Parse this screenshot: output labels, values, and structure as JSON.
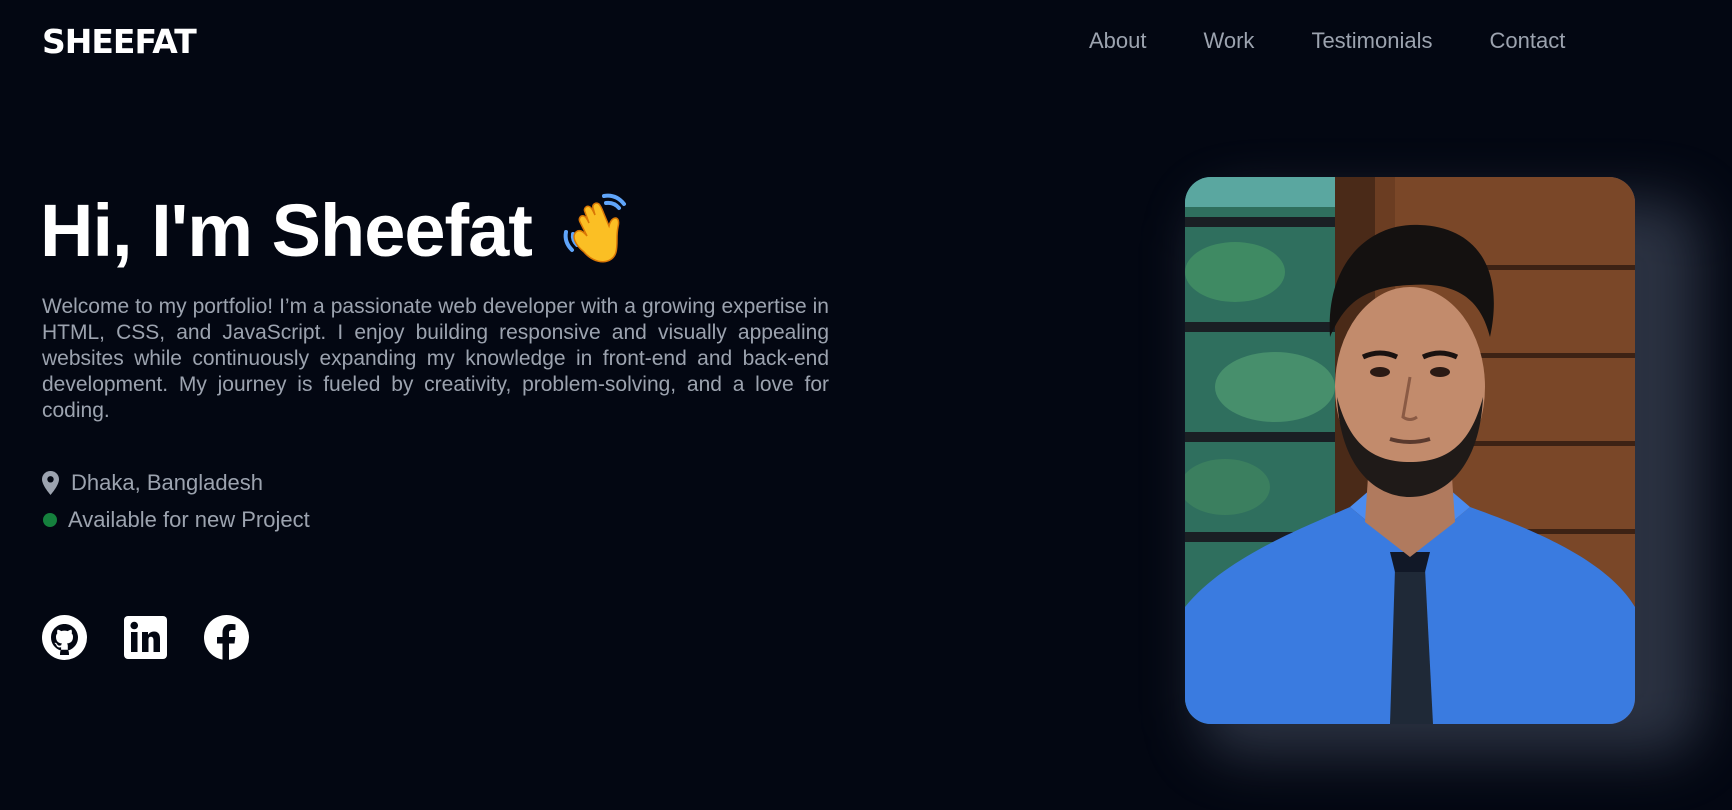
{
  "header": {
    "logo": "SHEEFAT",
    "nav": [
      "About",
      "Work",
      "Testimonials",
      "Contact"
    ]
  },
  "hero": {
    "title": "Hi, I'm Sheefat",
    "wave_icon": "waving-hand-emoji",
    "intro": "Welcome to my portfolio! I’m a passionate web developer with a growing expertise in HTML, CSS, and JavaScript. I enjoy building responsive and visually appealing websites while continuously expanding my knowledge in front-end and back-end development. My journey is fueled by creativity, problem-solving, and a love for coding.",
    "location": "Dhaka, Bangladesh",
    "availability": "Available for new Project",
    "availability_color": "#15803d"
  },
  "socials": [
    {
      "name": "github-icon"
    },
    {
      "name": "linkedin-icon"
    },
    {
      "name": "facebook-icon"
    }
  ],
  "photo": {
    "alt_icon": "profile-photo"
  },
  "colors": {
    "background": "#030712",
    "text_primary": "#ffffff",
    "text_muted": "#9ca3af"
  }
}
